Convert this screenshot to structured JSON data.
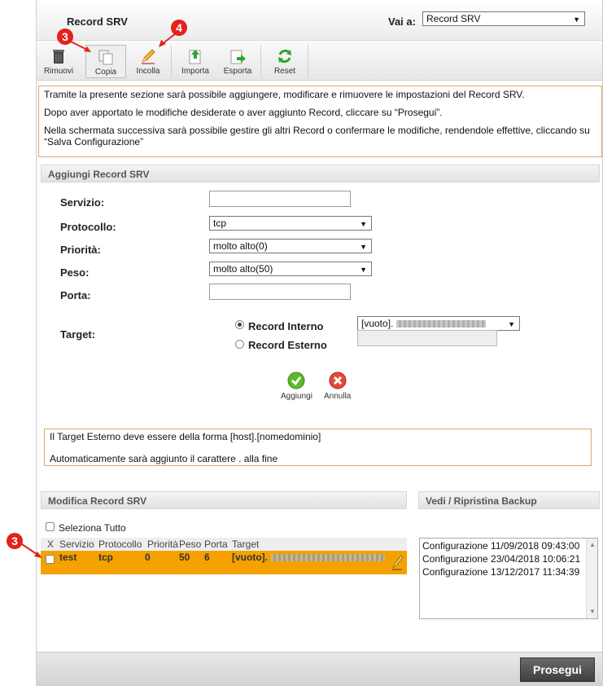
{
  "header": {
    "title": "Record SRV",
    "vai_label": "Vai a:",
    "vai_value": "Record SRV"
  },
  "toolbar": {
    "rimuovi": "Rimuovi",
    "copia": "Copia",
    "incolla": "Incolla",
    "importa": "Importa",
    "esporta": "Esporta",
    "reset": "Reset"
  },
  "info": {
    "line1": "Tramite la presente sezione sarà possibile aggiungere, modificare e rimuovere le impostazioni del Record SRV.",
    "line2": "Dopo aver apportato le modifiche desiderate o aver aggiunto Record, cliccare su “Prosegui”.",
    "line3": "Nella schermata successiva sarà possibile gestire gli altri Record o confermare le modifiche, rendendole effettive, cliccando su “Salva Configurazione”"
  },
  "add_section": {
    "header": "Aggiungi Record SRV",
    "servizio_label": "Servizio:",
    "protocollo_label": "Protocollo:",
    "protocollo_value": "tcp",
    "priorita_label": "Priorità:",
    "priorita_value": "molto alto(0)",
    "peso_label": "Peso:",
    "peso_value": "molto alto(50)",
    "porta_label": "Porta:",
    "target_label": "Target:",
    "record_interno": "Record Interno",
    "record_esterno": "Record Esterno",
    "target_value": "[vuoto].",
    "aggiungi": "Aggiungi",
    "annulla": "Annulla"
  },
  "note": {
    "line1": "Il Target Esterno deve essere della forma [host].[nomedominio]",
    "line2": "Automaticamente sarà aggiunto il carattere . alla fine"
  },
  "modify_section": {
    "header": "Modifica Record SRV",
    "select_all": "Seleziona Tutto",
    "columns": [
      "X",
      "Servizio",
      "Protocollo",
      "Priorità",
      "Peso",
      "Porta",
      "Target"
    ],
    "rows": [
      {
        "servizio": "test",
        "protocollo": "tcp",
        "priorita": "0",
        "peso": "50",
        "porta": "6",
        "target": "[vuoto]."
      }
    ]
  },
  "backup_section": {
    "header": "Vedi / Ripristina Backup",
    "items": [
      "Configurazione 11/09/2018 09:43:00",
      "Configurazione 23/04/2018 10:06:21",
      "Configurazione 13/12/2017 11:34:39"
    ]
  },
  "footer": {
    "prosegui": "Prosegui"
  },
  "annotations": {
    "badge_3": "3",
    "badge_4": "4",
    "badge_color": "#e3231b"
  },
  "colors": {
    "row_highlight": "#f5a100",
    "info_border": "#e0a867"
  }
}
